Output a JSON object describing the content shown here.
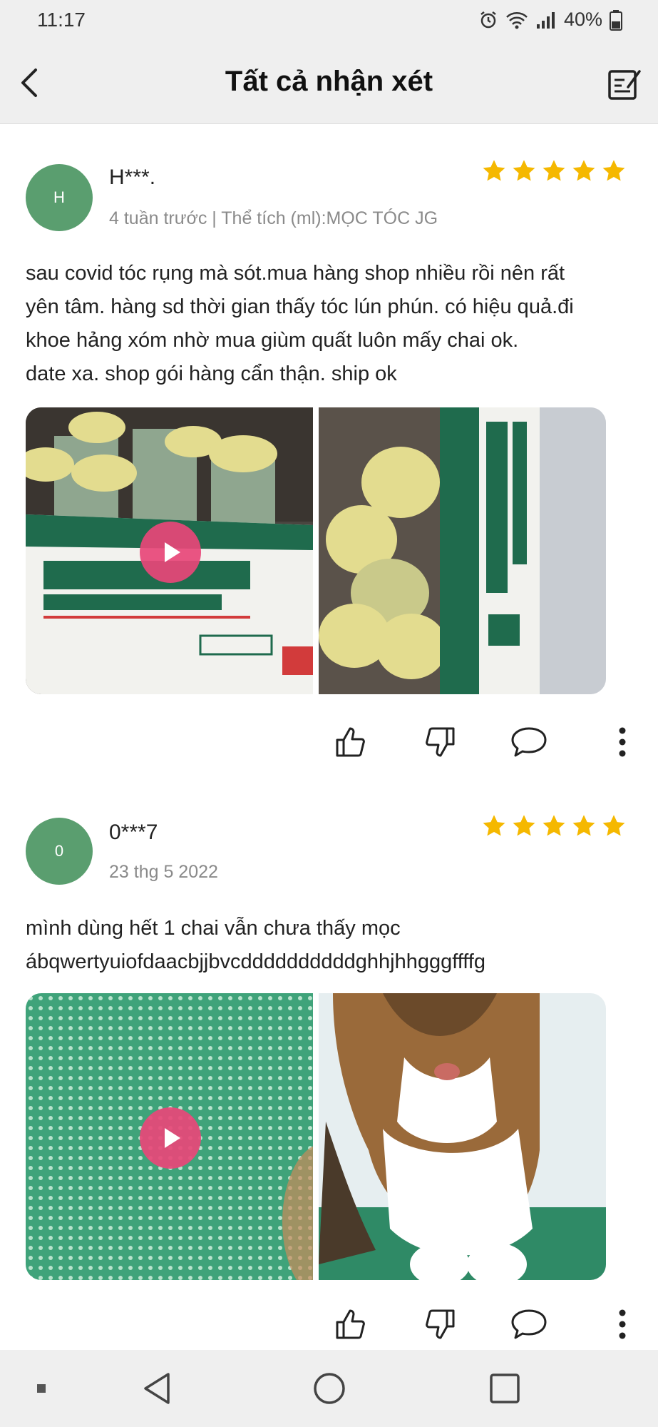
{
  "status_bar": {
    "time": "11:17",
    "battery": "40%"
  },
  "header": {
    "title": "Tất cả nhận xét"
  },
  "colors": {
    "star": "#f5b800",
    "avatar": "#5a9e6f",
    "play": "#e84678"
  },
  "reviews": [
    {
      "avatar_initial": "H",
      "username": "H***.",
      "meta": "4 tuần trước | Thể tích (ml):MỌC TÓC JG",
      "rating": 5,
      "text": "sau covid tóc rụng mà sót.mua hàng shop nhiều rồi nên rất\nyên tâm. hàng sd thời gian thấy tóc lún phún. có hiệu quả.đi\nkhoe hảng xóm nhờ mua giùm quất luôn mấy chai ok.\ndate xa. shop gói hàng cẩn thận. ship ok"
    },
    {
      "avatar_initial": "0",
      "username": "0***7",
      "meta": "23 thg 5 2022",
      "rating": 5,
      "text": "mình dùng hết 1 chai vẫn chưa thấy mọc\nábqwertyuiofdaacbjjbvcddddddddddghhjhhgggffffg"
    }
  ],
  "icons": {
    "like": "thumbs-up-icon",
    "dislike": "thumbs-down-icon",
    "comment": "comment-bubble-icon",
    "more": "more-vertical-icon"
  }
}
